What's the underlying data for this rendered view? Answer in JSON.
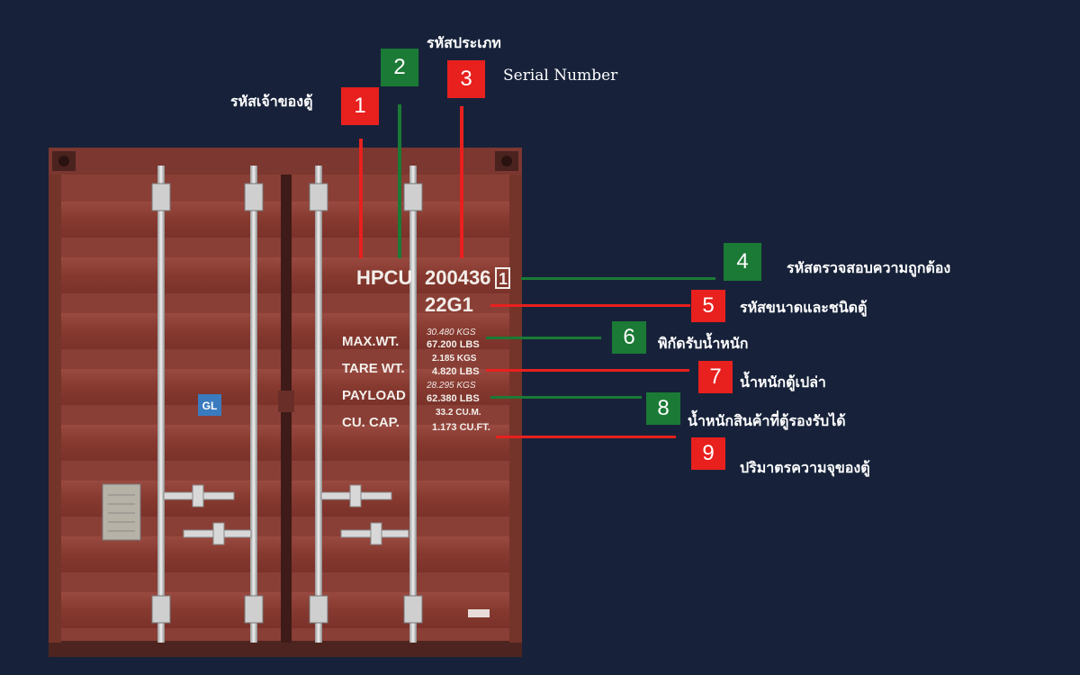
{
  "colors": {
    "background": "#17223a",
    "red": "#e8201e",
    "green": "#1b7a35",
    "container": "#8a3f36"
  },
  "callouts": [
    {
      "number": "1",
      "label": "รหัสเจ้าของตู้",
      "color": "red"
    },
    {
      "number": "2",
      "label": "รหัสประเภท",
      "color": "green"
    },
    {
      "number": "3",
      "label": "Serial Number",
      "color": "red"
    },
    {
      "number": "4",
      "label": "รหัสตรวจสอบความถูกต้อง",
      "color": "green"
    },
    {
      "number": "5",
      "label": "รหัสขนาดและชนิดตู้",
      "color": "red"
    },
    {
      "number": "6",
      "label": "พิกัดรับน้ำหนัก",
      "color": "green"
    },
    {
      "number": "7",
      "label": "น้ำหนักตู้เปล่า",
      "color": "red"
    },
    {
      "number": "8",
      "label": "น้ำหนักสินค้าที่ตู้รองรับได้",
      "color": "green"
    },
    {
      "number": "9",
      "label": "ปริมาตรความจุของตู้",
      "color": "red"
    }
  ],
  "container": {
    "owner_code": "HPCU",
    "serial": "200436",
    "check_digit": "1",
    "size_type": "22G1",
    "rows": [
      {
        "label": "MAX.WT.",
        "v1": "30.480 KGS",
        "v2": "67.200 LBS"
      },
      {
        "label": "TARE WT.",
        "v1": "2.185 KGS",
        "v2": "4.820 LBS"
      },
      {
        "label": "PAYLOAD",
        "v1": "28.295 KGS",
        "v2": "62.380 LBS"
      },
      {
        "label": "CU. CAP.",
        "v1": "33.2 CU.M.",
        "v2": "1.173 CU.FT."
      }
    ],
    "logo": "GL"
  }
}
